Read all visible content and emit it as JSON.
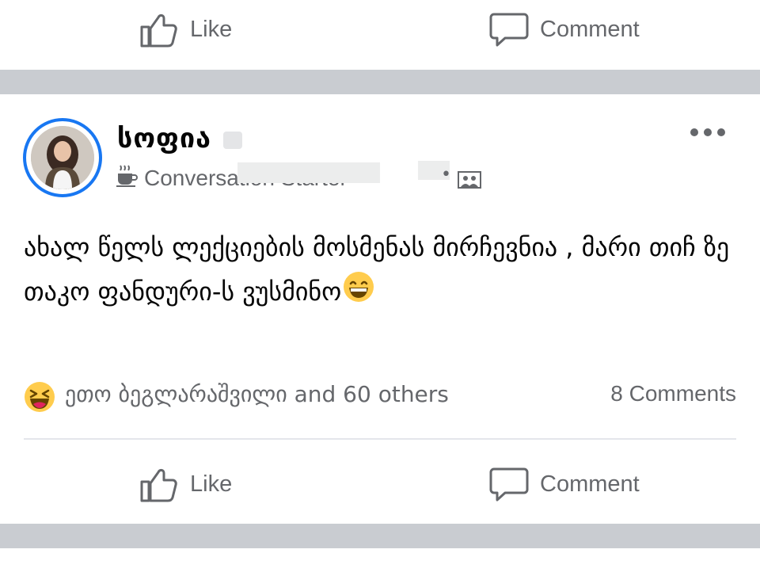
{
  "top_actions": {
    "like_label": "Like",
    "comment_label": "Comment"
  },
  "post": {
    "author_name": "სოფია",
    "badge_label": "Conversation Starter",
    "body_text": "ახალ წელს ლექციების მოსმენას მირჩევნია , მარი თიჩ ზე თაკო ფანდური-ს ვუსმინო",
    "reactions_text": "ეთო ბეგლარაშვილი and 60 others",
    "comments_count": "8 Comments",
    "like_label": "Like",
    "comment_label": "Comment"
  },
  "colors": {
    "accent": "#1877f2",
    "secondary_text": "#65676b",
    "divider": "#c9ccd1",
    "emoji_yellow": "#ffcc4d"
  },
  "icons": [
    "like-thumb-icon",
    "comment-bubble-icon",
    "coffee-cup-icon",
    "group-icon",
    "more-dots-icon",
    "laughing-emoji-icon",
    "grinning-emoji-icon"
  ]
}
